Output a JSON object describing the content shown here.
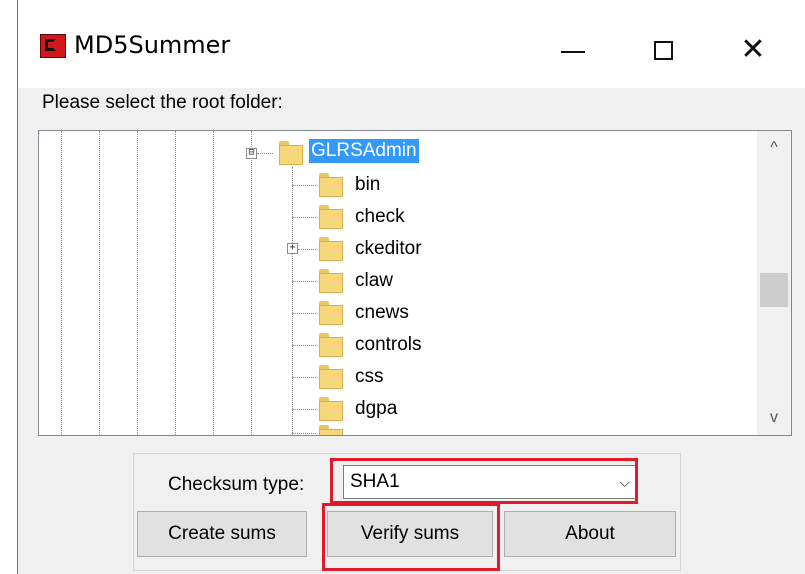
{
  "window": {
    "title": "MD5Summer",
    "app_icon": "md5summer-app-icon",
    "controls": {
      "minimize_icon": "minimize-icon",
      "maximize_icon": "maximize-icon",
      "close_icon": "close-icon"
    }
  },
  "prompt": "Please select the root folder:",
  "tree": {
    "selected": "GLRSAdmin",
    "nodes": [
      {
        "label": "GLRSAdmin",
        "expander": "⊟",
        "selected": true
      },
      {
        "label": "bin"
      },
      {
        "label": "check"
      },
      {
        "label": "ckeditor",
        "expander": "+"
      },
      {
        "label": "claw"
      },
      {
        "label": "cnews"
      },
      {
        "label": "controls"
      },
      {
        "label": "css"
      },
      {
        "label": "dgpa"
      }
    ],
    "scroll_up": "^",
    "scroll_down": "v"
  },
  "checksum": {
    "label": "Checksum type:",
    "value": "SHA1",
    "arrow": "⌵"
  },
  "buttons": {
    "create": "Create sums",
    "verify": "Verify sums",
    "about": "About"
  },
  "colors": {
    "highlight": "#e21b2c",
    "selection": "#3399ff",
    "folder": "#f6d77c"
  }
}
